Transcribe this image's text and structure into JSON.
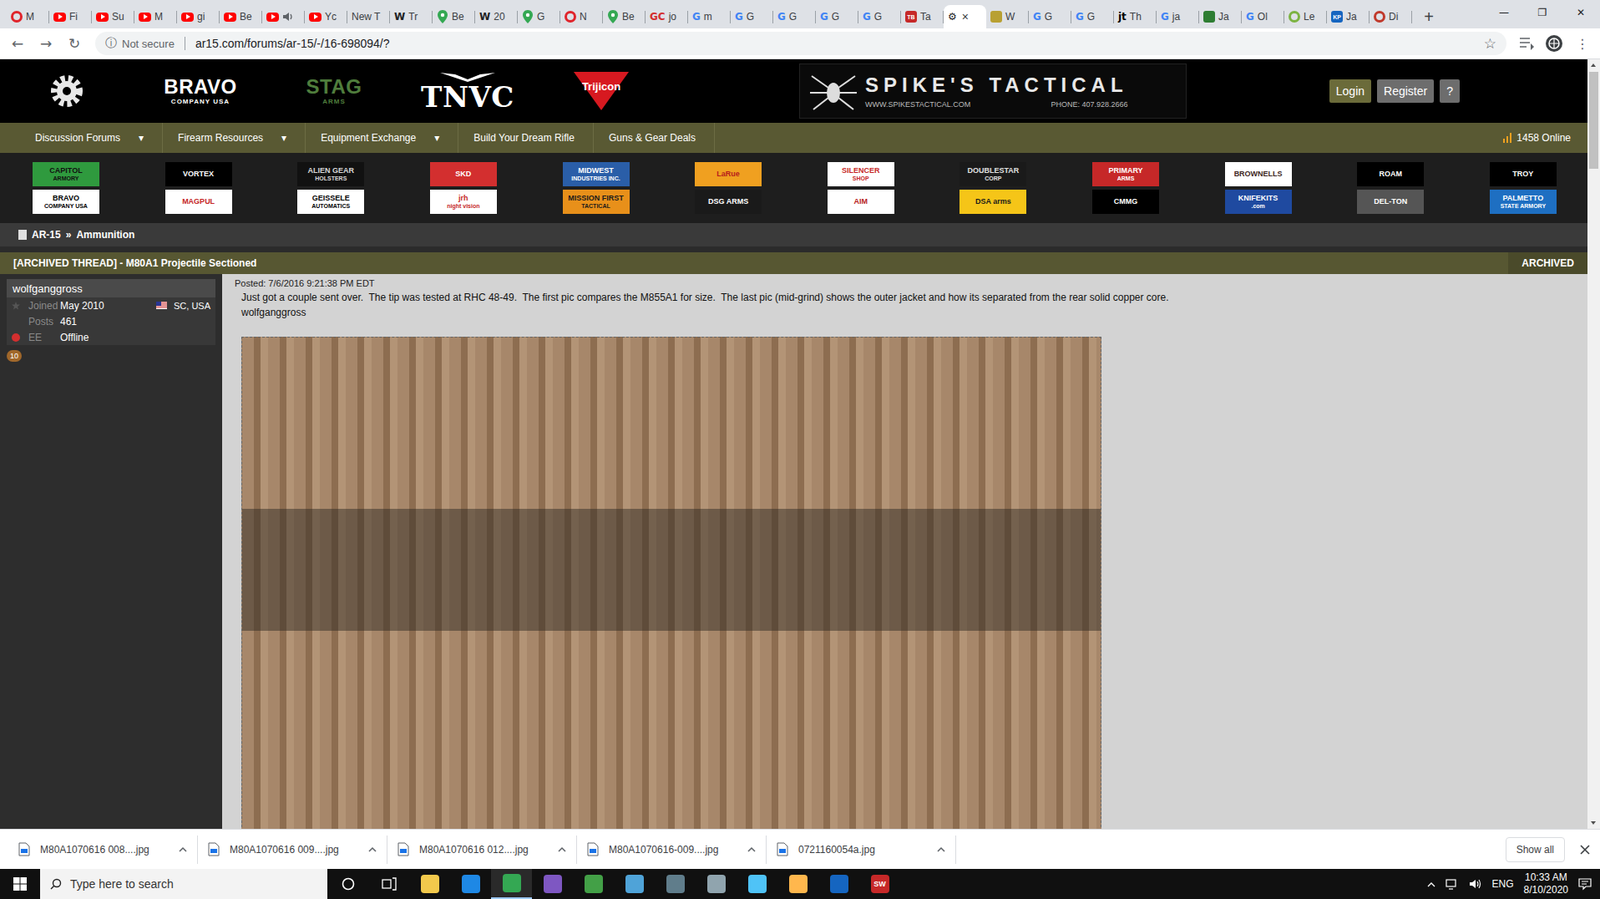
{
  "browser": {
    "tabs": [
      {
        "label": "M",
        "kind": "circle",
        "icon_text": "",
        "color": "#e0242b",
        "audio": false,
        "selected": false
      },
      {
        "label": "Fi",
        "kind": "play",
        "icon_text": "",
        "color": "#ff0000",
        "audio": false,
        "selected": false
      },
      {
        "label": "Su",
        "kind": "play",
        "icon_text": "",
        "color": "#ff0000",
        "audio": false,
        "selected": false
      },
      {
        "label": "M",
        "kind": "play",
        "icon_text": "",
        "color": "#ff0000",
        "audio": false,
        "selected": false
      },
      {
        "label": "gi",
        "kind": "play",
        "icon_text": "",
        "color": "#ff0000",
        "audio": false,
        "selected": false
      },
      {
        "label": "Be",
        "kind": "play",
        "icon_text": "",
        "color": "#ff0000",
        "audio": false,
        "selected": false
      },
      {
        "label": "",
        "kind": "play",
        "icon_text": "",
        "color": "#ff0000",
        "audio": true,
        "selected": false
      },
      {
        "label": "Yc",
        "kind": "play",
        "icon_text": "",
        "color": "#ff0000",
        "audio": false,
        "selected": false
      },
      {
        "label": "New T",
        "kind": "none",
        "icon_text": "",
        "color": "#5f6368",
        "audio": false,
        "selected": false
      },
      {
        "label": "Tr",
        "kind": "letter",
        "icon_text": "W",
        "color": "#202124",
        "audio": false,
        "selected": false
      },
      {
        "label": "Be",
        "kind": "pin",
        "icon_text": "",
        "color": "#34a853",
        "audio": false,
        "selected": false
      },
      {
        "label": "20",
        "kind": "letter",
        "icon_text": "W",
        "color": "#202124",
        "audio": false,
        "selected": false
      },
      {
        "label": "G",
        "kind": "pin",
        "icon_text": "",
        "color": "#34a853",
        "audio": false,
        "selected": false
      },
      {
        "label": "N",
        "kind": "circle",
        "icon_text": "",
        "color": "#e0242b",
        "audio": false,
        "selected": false
      },
      {
        "label": "Be",
        "kind": "pin",
        "icon_text": "",
        "color": "#34a853",
        "audio": false,
        "selected": false
      },
      {
        "label": "jo",
        "kind": "letter",
        "icon_text": "GC",
        "color": "#d32f2f",
        "audio": false,
        "selected": false
      },
      {
        "label": "m",
        "kind": "letter",
        "icon_text": "G",
        "color": "#4285f4",
        "audio": false,
        "selected": false
      },
      {
        "label": "G",
        "kind": "letter",
        "icon_text": "G",
        "color": "#4285f4",
        "audio": false,
        "selected": false
      },
      {
        "label": "G",
        "kind": "letter",
        "icon_text": "G",
        "color": "#4285f4",
        "audio": false,
        "selected": false
      },
      {
        "label": "G",
        "kind": "letter",
        "icon_text": "G",
        "color": "#4285f4",
        "audio": false,
        "selected": false
      },
      {
        "label": "G",
        "kind": "letter",
        "icon_text": "G",
        "color": "#4285f4",
        "audio": false,
        "selected": false
      },
      {
        "label": "Ta",
        "kind": "fill",
        "icon_text": "TB",
        "color": "#c62828",
        "audio": false,
        "selected": false
      },
      {
        "label": "",
        "kind": "letter",
        "icon_text": "⚙",
        "color": "#202124",
        "audio": false,
        "selected": true
      },
      {
        "label": "W",
        "kind": "fill",
        "icon_text": "",
        "color": "#b8a032",
        "audio": false,
        "selected": false
      },
      {
        "label": "G",
        "kind": "letter",
        "icon_text": "G",
        "color": "#4285f4",
        "audio": false,
        "selected": false
      },
      {
        "label": "G",
        "kind": "letter",
        "icon_text": "G",
        "color": "#4285f4",
        "audio": false,
        "selected": false
      },
      {
        "label": "Th",
        "kind": "letter",
        "icon_text": "jt",
        "color": "#000000",
        "audio": false,
        "selected": false
      },
      {
        "label": "ja",
        "kind": "letter",
        "icon_text": "G",
        "color": "#4285f4",
        "audio": false,
        "selected": false
      },
      {
        "label": "Ja",
        "kind": "fill",
        "icon_text": "",
        "color": "#2e7d32",
        "audio": false,
        "selected": false
      },
      {
        "label": "Ol",
        "kind": "letter",
        "icon_text": "G",
        "color": "#4285f4",
        "audio": false,
        "selected": false
      },
      {
        "label": "Le",
        "kind": "circle",
        "icon_text": "",
        "color": "#7cb342",
        "audio": false,
        "selected": false
      },
      {
        "label": "Ja",
        "kind": "fill",
        "icon_text": "KP",
        "color": "#1565c0",
        "audio": false,
        "selected": false
      },
      {
        "label": "Di",
        "kind": "circle",
        "icon_text": "",
        "color": "#c0392b",
        "audio": false,
        "selected": false
      }
    ],
    "close_tab": "×",
    "new_tab": "+",
    "window_controls": [
      "—",
      "❐",
      "✕"
    ],
    "nav_buttons": [
      "←",
      "→",
      "↻"
    ],
    "security_icon": "ⓘ",
    "security": "Not secure",
    "url": "ar15.com/forums/ar-15/-/16-698094/?",
    "bookmark": "☆",
    "menu": "⋮"
  },
  "header": {
    "logos": [
      {
        "lines": [
          "BRAVO",
          "COMPANY USA"
        ],
        "kind": "text",
        "color": "#ffffff"
      },
      {
        "lines": [
          "STAG",
          "ARMS"
        ],
        "kind": "text",
        "color": "#4f7d3c"
      },
      {
        "lines": [
          "TNVC"
        ],
        "kind": "wings",
        "color": "#ffffff"
      },
      {
        "lines": [
          "Trijicon"
        ],
        "kind": "triangle",
        "color": "#d71920"
      }
    ],
    "banner": {
      "title": "SPIKE'S TACTICAL",
      "url": "WWW.SPIKESTACTICAL.COM",
      "phone": "PHONE: 407.928.2666"
    },
    "buttons": [
      "Login",
      "Register",
      "?"
    ]
  },
  "nav": {
    "items": [
      {
        "label": "Discussion Forums",
        "dropdown": true
      },
      {
        "label": "Firearm Resources",
        "dropdown": true
      },
      {
        "label": "Equipment Exchange",
        "dropdown": true
      },
      {
        "label": "Build Your Dream Rifle",
        "dropdown": false
      },
      {
        "label": "Guns & Gear Deals",
        "dropdown": false
      }
    ],
    "caret": "▾",
    "online": "1458 Online"
  },
  "sponsors": [
    {
      "lines": [
        "CAPITOL",
        "ARMORY"
      ],
      "color": "#2f9a3e",
      "text_color": "#111111"
    },
    {
      "lines": [
        "VORTEX"
      ],
      "color": "#000000",
      "text_color": "#ffffff"
    },
    {
      "lines": [
        "ALIEN GEAR",
        "HOLSTERS"
      ],
      "color": "#111111",
      "text_color": "#d8d8d8"
    },
    {
      "lines": [
        "SKD"
      ],
      "color": "#d32f2f",
      "text_color": "#ffffff"
    },
    {
      "lines": [
        "MIDWEST",
        "INDUSTRIES INC."
      ],
      "color": "#2a5ea8",
      "text_color": "#ffffff"
    },
    {
      "lines": [
        "LaRue"
      ],
      "color": "#f0a020",
      "text_color": "#b71c1c"
    },
    {
      "lines": [
        "SILENCER",
        "SHOP"
      ],
      "color": "#ffffff",
      "text_color": "#c62828"
    },
    {
      "lines": [
        "DOUBLESTAR",
        "CORP"
      ],
      "color": "#1a1a1a",
      "text_color": "#e0e0e0"
    },
    {
      "lines": [
        "PRIMARY",
        "ARMS"
      ],
      "color": "#c62828",
      "text_color": "#ffffff"
    },
    {
      "lines": [
        "BROWNELLS"
      ],
      "color": "#ffffff",
      "text_color": "#3e2723"
    },
    {
      "lines": [
        "ROAM"
      ],
      "color": "#000000",
      "text_color": "#ffffff"
    },
    {
      "lines": [
        "TROY"
      ],
      "color": "#000000",
      "text_color": "#ffffff"
    },
    {
      "lines": [
        "BRAVO",
        "COMPANY USA"
      ],
      "color": "#ffffff",
      "text_color": "#000000"
    },
    {
      "lines": [
        "MAGPUL"
      ],
      "color": "#ffffff",
      "text_color": "#c62828"
    },
    {
      "lines": [
        "GEISSELE",
        "AUTOMATICS"
      ],
      "color": "#ffffff",
      "text_color": "#000000"
    },
    {
      "lines": [
        "jrh",
        "night vision"
      ],
      "color": "#ffffff",
      "text_color": "#c62828"
    },
    {
      "lines": [
        "MISSION FIRST",
        "TACTICAL"
      ],
      "color": "#e8901a",
      "text_color": "#1a1a1a"
    },
    {
      "lines": [
        "DSG ARMS"
      ],
      "color": "#1a1a1a",
      "text_color": "#ffffff"
    },
    {
      "lines": [
        "AIM"
      ],
      "color": "#ffffff",
      "text_color": "#b71c1c"
    },
    {
      "lines": [
        "DSA arms"
      ],
      "color": "#f5c518",
      "text_color": "#1a1a1a"
    },
    {
      "lines": [
        "CMMG"
      ],
      "color": "#000000",
      "text_color": "#ffffff"
    },
    {
      "lines": [
        "KNIFEKITS",
        ".com"
      ],
      "color": "#1f4aa0",
      "text_color": "#ffffff"
    },
    {
      "lines": [
        "DEL-TON"
      ],
      "color": "#555555",
      "text_color": "#ffffff"
    },
    {
      "lines": [
        "PALMETTO",
        "STATE ARMORY"
      ],
      "color": "#1e6fc2",
      "text_color": "#ffffff"
    }
  ],
  "breadcrumb": {
    "items": [
      "AR-15",
      "Ammunition"
    ],
    "separator": "»"
  },
  "thread": {
    "title": "[ARCHIVED THREAD] - M80A1 Projectile Sectioned",
    "status": "ARCHIVED"
  },
  "author": {
    "username": "wolfganggross",
    "location": "SC, USA",
    "stats": [
      {
        "label": "Joined",
        "value": "May 2010"
      },
      {
        "label": "Posts",
        "value": "461"
      },
      {
        "label": "EE",
        "value": "Offline"
      }
    ],
    "online": false,
    "badge": "10"
  },
  "post": {
    "posted": "Posted: 7/6/2016 9:21:38 PM EDT",
    "body": "Just got a couple sent over.  The tip was tested at RHC 48-49.  The first pic compares the M855A1 for size.  The last pic (mid-grind) shows the outer jacket and how its separated from the rear solid copper core.",
    "signature": "wolfganggross"
  },
  "scrollbar": {
    "level": 0,
    "thumb": 0.13
  },
  "downloads": {
    "items": [
      "M80A1070616 008....jpg",
      "M80A1070616 009....jpg",
      "M80A1070616 012....jpg",
      "M80A1070616-009....jpg",
      "0721160054a.jpg"
    ],
    "show_all": "Show all"
  },
  "taskbar": {
    "search_placeholder": "Type here to search",
    "apps": [
      {
        "color": "#f2c94c",
        "icon_text": "",
        "active": false
      },
      {
        "color": "#1e88e5",
        "icon_text": "",
        "active": false
      },
      {
        "color": "#34a853",
        "icon_text": "",
        "active": true
      },
      {
        "color": "#7e57c2",
        "icon_text": "",
        "active": false
      },
      {
        "color": "#43a047",
        "icon_text": "",
        "active": false
      },
      {
        "color": "#4fa3d8",
        "icon_text": "",
        "active": false
      },
      {
        "color": "#607d8b",
        "icon_text": "",
        "active": false
      },
      {
        "color": "#90a4ae",
        "icon_text": "",
        "active": false
      },
      {
        "color": "#4fc3f7",
        "icon_text": "",
        "active": false
      },
      {
        "color": "#ffb74d",
        "icon_text": "",
        "active": false
      },
      {
        "color": "#1565c0",
        "icon_text": "",
        "active": false
      },
      {
        "color": "#c62828",
        "icon_text": "SW",
        "active": false
      }
    ],
    "language": "ENG",
    "time": "10:33 AM",
    "date": "8/10/2020"
  }
}
